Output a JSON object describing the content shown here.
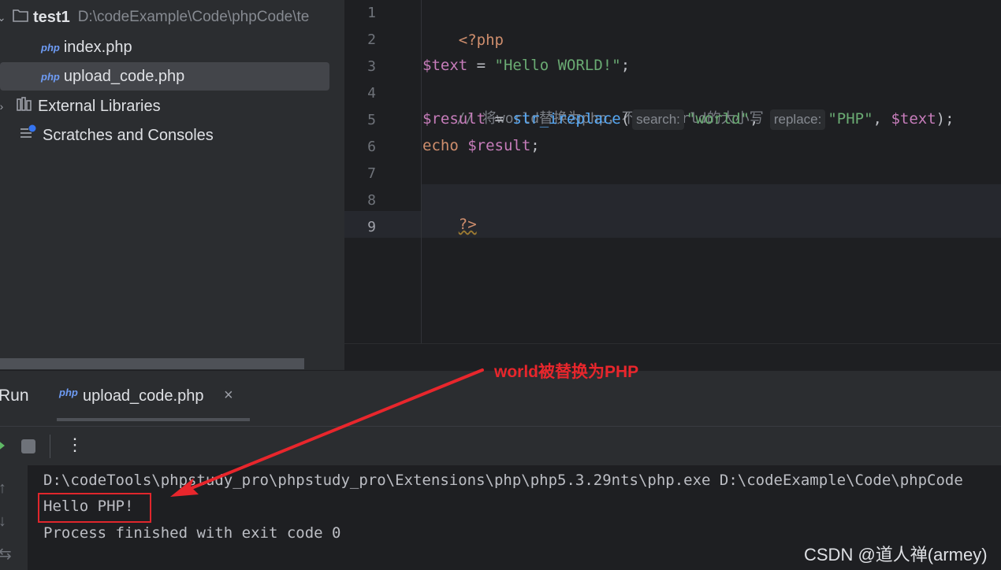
{
  "project_tree": {
    "root": {
      "name": "test1",
      "path": "D:\\codeExample\\Code\\phpCode\\te"
    },
    "files": [
      {
        "icon": "php",
        "label": "index.php"
      },
      {
        "icon": "php",
        "label": "upload_code.php"
      }
    ],
    "external_libraries": "External Libraries",
    "scratches": "Scratches and Consoles"
  },
  "editor": {
    "line_numbers": [
      "1",
      "2",
      "3",
      "4",
      "5",
      "6",
      "7",
      "8",
      "9"
    ],
    "code": {
      "l1": "<?php",
      "l3_var": "$text",
      "l3_eq": " = ",
      "l3_str": "\"Hello WORLD!\"",
      "l3_end": ";",
      "l4": "// 将world替换为php，不区分world的大小写",
      "l5_var": "$result",
      "l5_eq": " = ",
      "l5_fn": "str_ireplace",
      "l5_open": "(",
      "l5_hint1": "search:",
      "l5_str1": "\"world\"",
      "l5_comma1": ", ",
      "l5_hint2": "replace:",
      "l5_str2": "\"PHP\"",
      "l5_comma2": ", ",
      "l5_var2": "$text",
      "l5_end": ");",
      "l6_kw": "echo",
      "l6_sp": " ",
      "l6_var": "$result",
      "l6_end": ";",
      "l8": "?>"
    }
  },
  "run_panel": {
    "title": "Run",
    "tab_icon": "php",
    "tab_label": "upload_code.php",
    "close_glyph": "×",
    "more_glyph": "⋮",
    "console": [
      "D:\\codeTools\\phpstudy_pro\\phpstudy_pro\\Extensions\\php\\php5.3.29nts\\php.exe D:\\codeExample\\Code\\phpCode",
      "Hello PHP!",
      "Process finished with exit code 0"
    ]
  },
  "annotation": {
    "text": "world被替换为PHP",
    "color": "#e8262c"
  },
  "watermark": "CSDN @道人禅(armey)"
}
